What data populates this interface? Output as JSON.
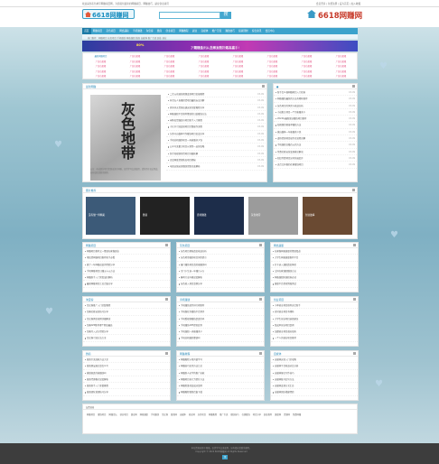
{
  "topbar": {
    "left": "欢迎来到灰色地带网赚项目网，为您提供最新的网赚项目、网赚技巧、副业创业资讯",
    "right": "会员登录 | 免费注册 | 设为首页 | 加入收藏"
  },
  "logo_text": "6618网赚网",
  "logo2_text": "6618网赚网",
  "search": {
    "placeholder": "",
    "button": "搜"
  },
  "nav": [
    "首页",
    "网赚项目",
    "灰色项目",
    "网络兼职",
    "手机赚钱",
    "淘宝客",
    "微商",
    "创业项目",
    "网赚教程",
    "副业",
    "自媒体",
    "推广引流",
    "赚钱技巧",
    "投资理财",
    "综合资讯",
    "会员中心"
  ],
  "subnav": "热门推荐：网赚项目 灰色项目 手机赚钱 网络兼职 微商 自媒体 推广引流 副业 创业",
  "banner": {
    "text": "下载赚金，从此淘宝购物最高省",
    "percent": "80%",
    "text2": "，赚钱比例。立即入驻，达人高手!"
  },
  "linkgrid": [
    [
      "最新网赚项目",
      "广告位招租",
      "广告位招租",
      "广告位招租",
      "广告位招租",
      "广告位招租",
      "广告位招租",
      "广告位招租"
    ],
    [
      "广告位招租",
      "广告位招租",
      "广告位招租",
      "广告位招租",
      "广告位招租",
      "广告位招租",
      "广告位招租",
      "广告位招租"
    ],
    [
      "广告位招租",
      "广告位招租",
      "广告位招租",
      "广告位招租",
      "广告位招租",
      "广告位招租",
      "广告位招租",
      "广告位招租"
    ],
    [
      "广告位招租",
      "广告位招租",
      "广告位招租",
      "广告位招租",
      "广告位招租",
      "广告位招租",
      "广告位招租",
      "广告位招租"
    ],
    [
      "广告位招租",
      "广告位招租",
      "广告位招租",
      "广告位招租",
      "广告位招租",
      "广告位招租",
      "广告位招租",
      "广告位招租"
    ]
  ],
  "feature": {
    "title": "最新网赚",
    "img_text": "灰色地带",
    "caption": "公告：本站部分项目资源来源于网络，仅供学习交流使用，请勿用于违法用途，如有侵权请联系删除。"
  },
  "feature_list": [
    [
      "二次元动漫短视频变现项目实操教程",
      "03-09"
    ],
    [
      "抖音无人直播带货项目最新玩法详解",
      "03-09"
    ],
    [
      "拼多多无货源店铺运营全套教程分享",
      "03-09"
    ],
    [
      "网络兼职平台推荐靠谱的日结赚钱方法",
      "03-09"
    ],
    [
      "闲鱼卖货赚差价项目新手入门教程",
      "03-09"
    ],
    [
      "小红书引流变现项目完整操作流程",
      "03-09"
    ],
    [
      "头条号自媒体写作赚钱项目实战分享",
      "03-09"
    ],
    [
      "手机挂机赚钱项目一天能赚多少钱",
      "03-09"
    ],
    [
      "公众号流量主项目从零到一运营攻略",
      "03-09"
    ],
    [
      "快手短视频带货项目详细拆解",
      "03-09"
    ],
    [
      "百度网盘资源售卖项目揭秘",
      "03-09"
    ],
    [
      "电商店铺运营赚钱思路全面解析",
      "03-09"
    ]
  ],
  "side_list": [
    [
      "新手怎么做网赚项目入门指南",
      "03-09"
    ],
    [
      "网络赚钱最快的方法有哪些推荐",
      "03-09"
    ],
    [
      "灰色项目的风险与收益分析",
      "03-09"
    ],
    [
      "小说推文项目一个月能赚多少",
      "03-09"
    ],
    [
      "2024年最新副业赚钱项目推荐",
      "03-09"
    ],
    [
      "短视频剪辑接单赚钱方法",
      "03-09"
    ],
    [
      "做自媒体一年能赚多少钱",
      "03-09"
    ],
    [
      "虚拟资源项目操作全流程讲解",
      "03-09"
    ],
    [
      "手机兼职日赚百元的方法",
      "03-09"
    ],
    [
      "付费社群运营变现模式解读",
      "03-09"
    ],
    [
      "知识付费项目如何快速起步",
      "03-09"
    ],
    [
      "适合宝妈做的在家赚钱项目",
      "03-09"
    ]
  ],
  "gallery": {
    "title": "图片推荐",
    "items": [
      "没有做一样精彩",
      "微商",
      "游戏赚钱",
      "灰色地带",
      "创业故事",
      "网赚项目"
    ]
  },
  "sections_row1": [
    {
      "title": "网赚项目",
      "items": [
        "网赚项目推荐之一靠谱在家做副业",
        "零投资网赚项目推荐新手必看",
        "做了一年网赚总结的经验分享",
        "手机网赚项目日赚五十元方法",
        "网赚新手入门常见误区解析",
        "最新网赚项目汇总合集分享"
      ]
    },
    {
      "title": "灰色项目",
      "items": [
        "灰色项目揭秘真实收益分析",
        "灰色地带赚钱项目风险提示",
        "偏门赚钱项目真的能赚钱吗",
        "冷门小生意一年赚几十万",
        "暴利行业内幕深度解析",
        "灰色收入项目案例分享"
      ]
    },
    {
      "title": "网络兼职",
      "items": [
        "在家做网络兼职的靠谱渠道",
        "大学生网络兼职推荐平台",
        "打字录入兼职真实体验",
        "宝妈在家兼职赚钱方法",
        "网络兼职防骗指南必读",
        "兼职平台提现到账测试"
      ]
    }
  ],
  "sections_row2": [
    {
      "title": "淘宝客",
      "items": [
        "淘宝客推广入门全套教程",
        "淘客社群运营技巧分享",
        "淘宝客佣金规则详细解读",
        "淘客APP推荐哪个佣金最高",
        "淘客月入过万经验分享",
        "淘宝客引流方法大全"
      ]
    },
    {
      "title": "手机赚钱",
      "items": [
        "手机赚钱软件排行榜推荐",
        "手机做任务赚钱平台测评",
        "手机看视频赚钱是真的吗",
        "手机赚钱APP提现实测",
        "手机兼职一天能赚多少",
        "手机挂机赚钱靠谱吗"
      ]
    },
    {
      "title": "创业项目",
      "items": [
        "小本创业项目推荐适合新手",
        "农村创业项目有哪些",
        "大学生创业项目选择建议",
        "低成本创业项目案例",
        "加盟创业项目避坑指南",
        "一个人的创业项目推荐"
      ]
    }
  ],
  "sections_row3": [
    {
      "title": "微商",
      "items": [
        "微商引流加粉方法大全",
        "微商朋友圈文案怎么写",
        "做微商真的能赚钱吗",
        "微商代理模式深度解析",
        "微商新手入门全套教程",
        "微商团队管理技巧分享"
      ]
    },
    {
      "title": "网赚教程",
      "items": [
        "网赚教程从零开始学习",
        "网赚技巧实用方法汇总",
        "网赚新人必学的推广技能",
        "网赚项目执行力提升方法",
        "网赚思维转变成功案例",
        "网赚教程视频合集下载"
      ]
    },
    {
      "title": "自媒体",
      "items": [
        "自媒体运营入门全攻略",
        "自媒体平台收益对比分析",
        "自媒体爆文写作技巧",
        "自媒体账号起号方法",
        "自媒体变现方式汇总",
        "自媒体团队搭建经验"
      ]
    }
  ],
  "tags": {
    "title": "友情链接",
    "items": [
      "网赚项目",
      "赚钱项目",
      "网赚论坛",
      "创业项目",
      "副业网",
      "网络兼职",
      "手机赚钱",
      "淘宝客",
      "微商网",
      "自媒体",
      "创业网",
      "灰色项目",
      "网赚教程",
      "推广引流",
      "赚钱技巧",
      "在线赚钱",
      "项目分享",
      "副业推荐",
      "兼职网",
      "资源网",
      "免费网赚"
    ]
  },
  "footer": {
    "line1": "本站资源来源于网络，仅供学习交流使用，如有侵权请联系删除。",
    "line2": "Copyright © 2024 6618网赚网 All Rights Reserved",
    "btn": "顶"
  }
}
